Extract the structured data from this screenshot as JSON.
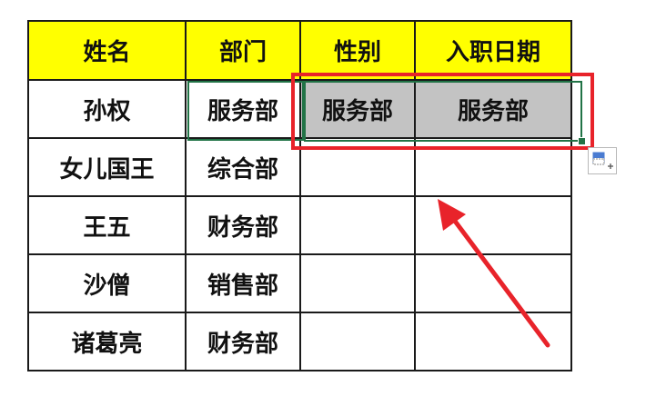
{
  "sheet": {
    "headers": [
      "姓名",
      "部门",
      "性别",
      "入职日期"
    ],
    "rows": [
      [
        "孙权",
        "服务部",
        "服务部",
        "服务部"
      ],
      [
        "女儿国王",
        "综合部",
        "",
        ""
      ],
      [
        "王五",
        "财务部",
        "",
        ""
      ],
      [
        "沙僧",
        "销售部",
        "",
        ""
      ],
      [
        "诸葛亮",
        "财务部",
        "",
        ""
      ]
    ]
  },
  "colors": {
    "header_fill": "#ffff00",
    "selection_fill": "#c3c3c3",
    "selection_border": "#217346",
    "highlight_box": "#e8232a",
    "arrow": "#e8232a"
  },
  "icons": {
    "autofill_options": "autofill-options-icon"
  }
}
